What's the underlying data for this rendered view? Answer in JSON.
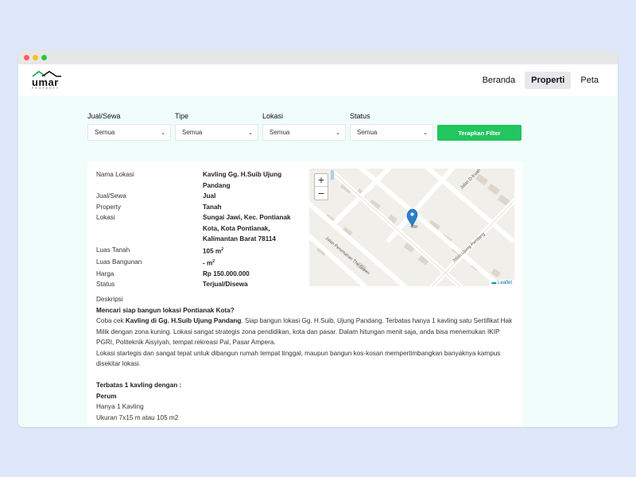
{
  "nav": {
    "logo_word": "umar",
    "logo_sub": "PROPERTY",
    "links": [
      "Beranda",
      "Properti",
      "Peta"
    ]
  },
  "filters": {
    "groups": [
      {
        "label": "Jual/Sewa",
        "value": "Semua"
      },
      {
        "label": "Tipe",
        "value": "Semua"
      },
      {
        "label": "Lokasi",
        "value": "Semua"
      },
      {
        "label": "Status",
        "value": "Semua"
      }
    ],
    "apply_label": "Terapkan Filter"
  },
  "details": {
    "nama_label": "Nama Lokasi",
    "nama_value": "Kavling Gg. H.Suib Ujung Pandang",
    "jual_label": "Jual/Sewa",
    "jual_value": "Jual",
    "property_label": "Property",
    "property_value": "Tanah",
    "lokasi_label": "Lokasi",
    "lokasi_value": "Sungai Jawi, Kec. Pontianak Kota, Kota Pontianak, Kalimantan Barat 78114",
    "luas_tanah_label": "Luas Tanah",
    "luas_tanah_value": "105 m",
    "luas_bangunan_label": "Luas Bangunan",
    "luas_bangunan_value": "- m",
    "unit_sup": "2",
    "harga_label": "Harga",
    "harga_value": "Rp 150.000.000",
    "status_label": "Status",
    "status_value": "Terjual/Disewa"
  },
  "map": {
    "zoom_in": "+",
    "zoom_out": "−",
    "attribution": "Leaflet",
    "street_1": "Jalan D-Kuah",
    "street_2": "Jalan Ujung Pandang",
    "street_3": "Jalan Perumahan The Green"
  },
  "description": {
    "heading": "Deskripsi",
    "headline": "Mencari siap bangun lokasi Pontianak Kota?",
    "p1_pre": "Coba cek ",
    "p1_bold": "Kavling di Gg. H.Suib Ujung Pandang",
    "p1_post": ". Siap bangun lokasi Gg. H.Suib, Ujung Pandang. Terbatas hanya 1 kavling satu Sertifikat Hak Milik dengan zona kuning. Lokasi sangat strategis zona pendidikan, kota dan pasar. Dalam hitungan menit saja, anda bisa menemukan IKIP PGRI, Politeknik Aisyiyah, tempat rekreasi Pal, Pasar Ampera.",
    "p2": "Lokasi startegis dan sangat tepat untuk dibangun rumah tempat tinggal, maupun bangun kos-kosan mempertimbangkan banyaknya kampus disekitar lokasi.",
    "terbatas": "Terbatas 1 kavling dengan :",
    "perum": "Perum",
    "hanya": "Hanya 1 Kavling",
    "ukuran": "Ukuran 7x15 m atau 105 m2"
  },
  "colors": {
    "accent": "#22c55e",
    "marker": "#2a81cb"
  }
}
